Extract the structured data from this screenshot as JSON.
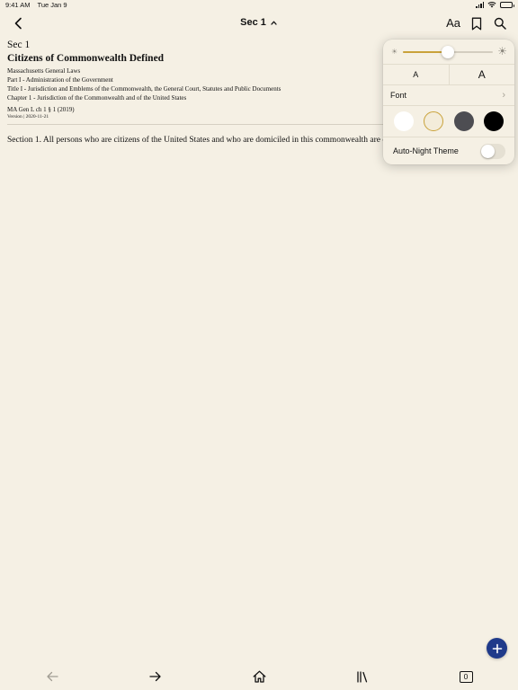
{
  "status_bar": {
    "time": "9:41 AM",
    "date": "Tue Jan 9"
  },
  "nav": {
    "title": "Sec 1",
    "text_size_label": "Aa"
  },
  "document": {
    "section_label": "Sec 1",
    "title": "Citizens of Commonwealth Defined",
    "hierarchy": [
      "Massachusetts General Laws",
      "Part I - Administration of the Government",
      "Title I - Jurisdiction and Emblems of the Commonwealth, the General Court, Statutes and Public Documents",
      "Chapter 1 - Jurisdiction of the Commonwealth and of the United States"
    ],
    "citation": "MA Gen L ch 1 § 1 (2019)",
    "version": "Version | 2020-11-21",
    "body": "Section 1. All persons who are citizens of the United States and who are domiciled in this commonwealth are citizens thereof."
  },
  "display_settings": {
    "brightness": 0.5,
    "text_smaller_label": "A",
    "text_larger_label": "A",
    "font_label": "Font",
    "themes": [
      {
        "name": "white",
        "color": "#ffffff",
        "selected": false
      },
      {
        "name": "sepia",
        "color": "#f3ecda",
        "selected": true
      },
      {
        "name": "gray",
        "color": "#4d4d52",
        "selected": false
      },
      {
        "name": "black",
        "color": "#000000",
        "selected": false
      }
    ],
    "selected_ring_color": "#c9a23a",
    "auto_night_label": "Auto-Night Theme",
    "auto_night_on": false
  },
  "toolbar": {
    "tab_count": "0"
  },
  "colors": {
    "background": "#f5f0e4",
    "accent": "#c9a23a",
    "fab": "#1f3a8a"
  }
}
